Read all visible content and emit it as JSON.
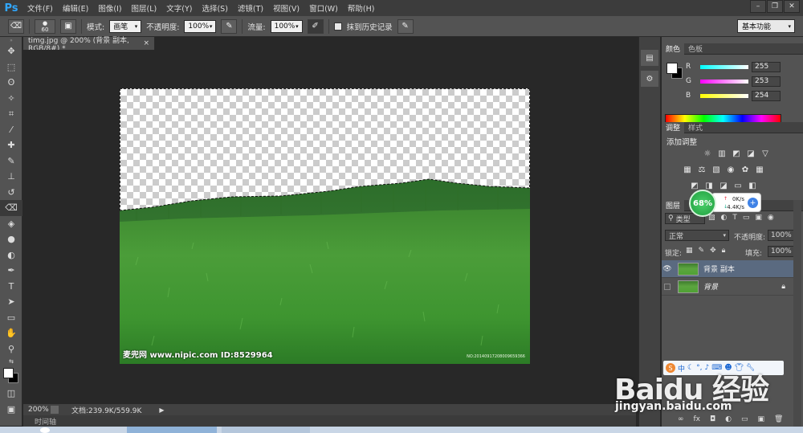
{
  "menubar": {
    "logo": "Ps",
    "items": [
      "文件(F)",
      "编辑(E)",
      "图像(I)",
      "图层(L)",
      "文字(Y)",
      "选择(S)",
      "滤镜(T)",
      "视图(V)",
      "窗口(W)",
      "帮助(H)"
    ]
  },
  "options": {
    "brush_size": "60",
    "mode_label": "模式:",
    "mode_value": "画笔",
    "opacity_label": "不透明度:",
    "opacity_value": "100%",
    "flow_label": "流量:",
    "flow_value": "100%",
    "history_label": "抹到历史记录",
    "workspace": "基本功能"
  },
  "document": {
    "tab_title": "timg.jpg @ 200% (背景 副本, RGB/8#) *",
    "watermark_left": "麦兜网 www.nipic.com  ID:8529964",
    "watermark_right": "NO:20140917208009659366"
  },
  "status": {
    "zoom": "200%",
    "doc_info": "文档:239.9K/559.9K"
  },
  "timeline": {
    "label": "时间轴"
  },
  "color_panel": {
    "tabs": [
      "颜色",
      "色板"
    ],
    "r_label": "R",
    "r_value": "255",
    "g_label": "G",
    "g_value": "253",
    "b_label": "B",
    "b_value": "254"
  },
  "adjust_panel": {
    "tabs": [
      "调整",
      "样式"
    ],
    "title": "添加调整"
  },
  "layers_panel": {
    "tabs": [
      "图层"
    ],
    "filter_label": "类型",
    "blend_mode": "正常",
    "opacity_label": "不透明度:",
    "opacity_value": "100%",
    "lock_label": "锁定:",
    "fill_label": "填充:",
    "fill_value": "100%",
    "layers": [
      {
        "name": "背景 副本",
        "visible": true,
        "selected": true
      },
      {
        "name": "背景",
        "visible": false,
        "selected": false
      }
    ]
  },
  "speed_widget": {
    "percent": "68%",
    "up": "0K/s",
    "down": "4.4K/s"
  },
  "baidu": {
    "logo": "Baidu 经验",
    "url": "jingyan.baidu.com"
  },
  "colors": {
    "accent": "#31a8ff",
    "panel_bg": "#535353",
    "canvas_bg": "#282828"
  }
}
